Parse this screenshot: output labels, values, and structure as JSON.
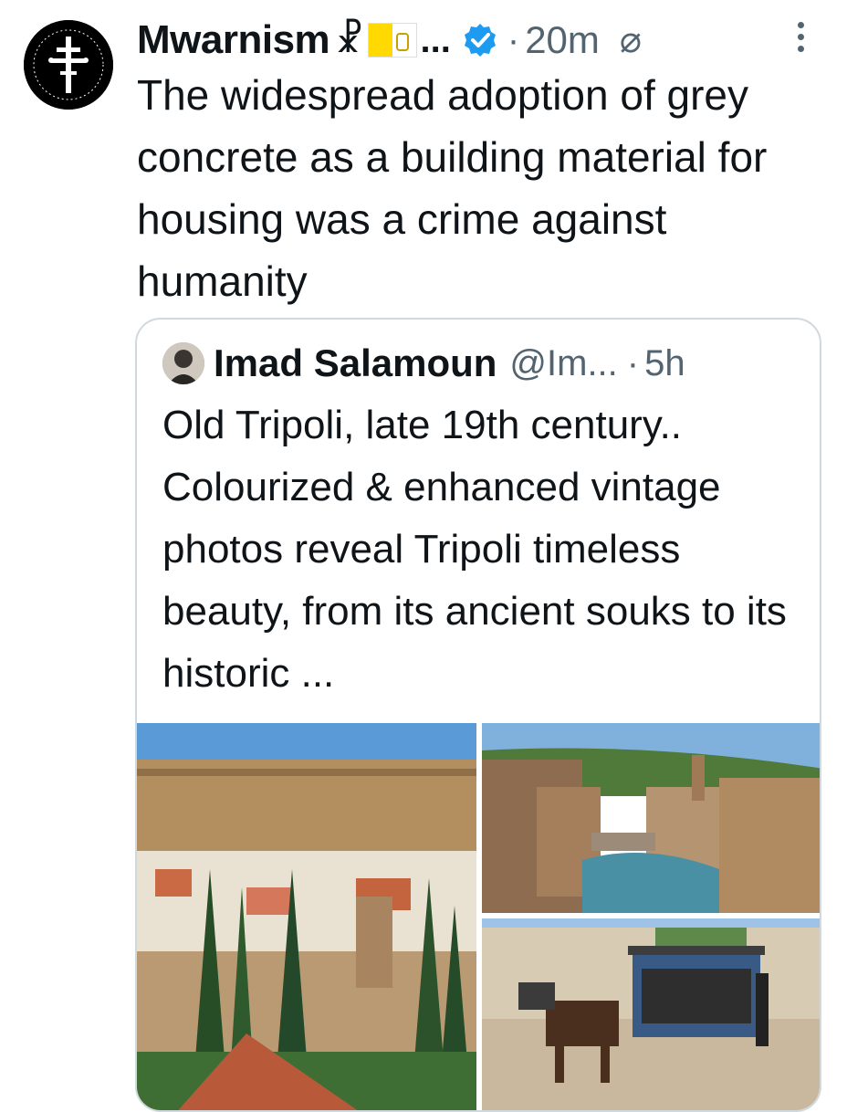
{
  "tweet": {
    "author_name": "Mwarnism",
    "chi_rho": "☧",
    "name_ellipsis": "...",
    "separator": "·",
    "time": "20m",
    "text": "The widespread adoption of grey concrete as a building material for housing was a crime against humanity",
    "icons": [
      "cross-avatar-icon",
      "vatican-flag-icon",
      "verified-badge-icon",
      "slashed-circle-icon",
      "more-options-icon"
    ],
    "colors": {
      "verified": "#1d9bf0",
      "secondary_text": "#536471",
      "border": "#cfd9de"
    }
  },
  "quoted_tweet": {
    "author_name": "Imad Salamoun",
    "handle": "@Im...",
    "separator": "·",
    "time": "5h",
    "text": "Old Tripoli, late 19th century.. Colourized & enhanced vintage photos reveal Tripoli timeless beauty, from its ancient souks to its historic ..."
  }
}
